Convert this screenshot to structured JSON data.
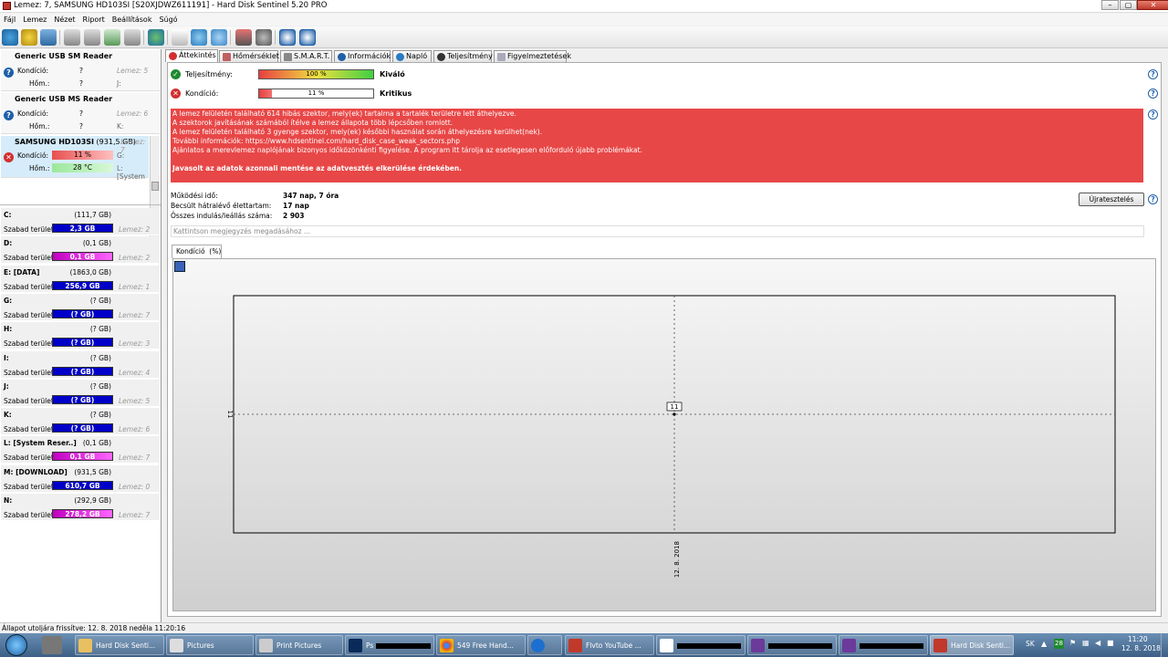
{
  "window": {
    "title": "Lemez: 7, SAMSUNG HD103SI [S20XJDWZ611191] - Hard Disk Sentinel 5.20 PRO"
  },
  "menu": [
    "Fájl",
    "Lemez",
    "Nézet",
    "Riport",
    "Beállítások",
    "Súgó"
  ],
  "disks": [
    {
      "name": "Generic USB SM Reader",
      "cond_label": "Kondíció:",
      "cond_value": "?",
      "cond_lemez": "Lemez: 5",
      "temp_label": "Hőm.:",
      "temp_value": "?",
      "temp_drive": "J:"
    },
    {
      "name": "Generic USB MS Reader",
      "cond_label": "Kondíció:",
      "cond_value": "?",
      "cond_lemez": "Lemez: 6",
      "temp_label": "Hőm.:",
      "temp_value": "?",
      "temp_drive": "K:"
    },
    {
      "name": "SAMSUNG HD103SI",
      "size": "(931,5 GB)",
      "lemez": "Lemez: 7",
      "cond_label": "Kondíció:",
      "cond_value": "11 %",
      "cond_drive": "G:",
      "temp_label": "Hőm.:",
      "temp_value": "28 °C",
      "temp_drive": "L: [System"
    }
  ],
  "volumes": [
    {
      "name": "C:",
      "size": "(111,7 GB)",
      "free_label": "Szabad terület",
      "free": "2,3 GB",
      "lemez": "Lemez: 2",
      "style": "blue"
    },
    {
      "name": "D:",
      "size": "(0,1 GB)",
      "free_label": "Szabad terület",
      "free": "0,1 GB",
      "lemez": "Lemez: 2",
      "style": "mag"
    },
    {
      "name": "E: [DATA]",
      "size": "(1863,0 GB)",
      "free_label": "Szabad terület",
      "free": "256,9 GB",
      "lemez": "Lemez: 1",
      "style": "blue"
    },
    {
      "name": "G:",
      "size": "(? GB)",
      "free_label": "Szabad terület",
      "free": "(? GB)",
      "lemez": "Lemez: 7",
      "style": "blue"
    },
    {
      "name": "H:",
      "size": "(? GB)",
      "free_label": "Szabad terület",
      "free": "(? GB)",
      "lemez": "Lemez: 3",
      "style": "blue"
    },
    {
      "name": "I:",
      "size": "(? GB)",
      "free_label": "Szabad terület",
      "free": "(? GB)",
      "lemez": "Lemez: 4",
      "style": "blue"
    },
    {
      "name": "J:",
      "size": "(? GB)",
      "free_label": "Szabad terület",
      "free": "(? GB)",
      "lemez": "Lemez: 5",
      "style": "blue"
    },
    {
      "name": "K:",
      "size": "(? GB)",
      "free_label": "Szabad terület",
      "free": "(? GB)",
      "lemez": "Lemez: 6",
      "style": "blue"
    },
    {
      "name": "L: [System Reser..]",
      "size": "(0,1 GB)",
      "free_label": "Szabad terület",
      "free": "0,1 GB",
      "lemez": "Lemez: 7",
      "style": "mag"
    },
    {
      "name": "M: [DOWNLOAD]",
      "size": "(931,5 GB)",
      "free_label": "Szabad terület",
      "free": "610,7 GB",
      "lemez": "Lemez: 0",
      "style": "blue"
    },
    {
      "name": "N:",
      "size": "(292,9 GB)",
      "free_label": "Szabad terület",
      "free": "278,2 GB",
      "lemez": "Lemez: 7",
      "style": "mag"
    }
  ],
  "tabs": [
    "Áttekintés",
    "Hőmérséklet",
    "S.M.A.R.T.",
    "Információk",
    "Napló",
    "Teljesítmény",
    "Figyelmeztetések"
  ],
  "overview": {
    "performance_label": "Teljesítmény:",
    "performance_percent": 100,
    "performance_text": "100 %",
    "performance_status": "Kiváló",
    "health_label": "Kondíció:",
    "health_percent": 11,
    "health_text": "11 %",
    "health_status": "Kritikus",
    "alert_lines": [
      "A lemez felületén található 614 hibás szektor, mely(ek) tartalma a tartalék területre lett áthelyezve.",
      "A szektorok javításának számából ítélve a lemez állapota több lépcsőben romlott.",
      "A lemez felületén található 3 gyenge szektor, mely(ek) későbbi használat során áthelyezésre kerülhet(nek).",
      "További információk: https://www.hdsentinel.com/hard_disk_case_weak_sectors.php",
      "Ajánlatos a merevlemez naplójának bizonyos időközönkénti figyelése. A program itt tárolja az esetlegesen előforduló újabb problémákat."
    ],
    "alert_recommendation": "Javasolt az adatok azonnali mentése az adatvesztés elkerülése érdekében.",
    "uptime_label": "Működési idő:",
    "uptime": "347 nap, 7 óra",
    "remaining_label": "Becsült hátralévő élettartam:",
    "remaining": "17 nap",
    "starts_label": "Összes indulás/leállás száma:",
    "starts": "2 903",
    "retest_label": "Újratesztelés",
    "note_placeholder": "Kattintson megjegyzés megadásához ..."
  },
  "chart_tab": "Kondíció  (%)",
  "chart_data": {
    "type": "line",
    "x": [
      "12. 8. 2018"
    ],
    "series": [
      {
        "values": [
          11
        ]
      }
    ],
    "data_labels": [
      "11"
    ],
    "ytick": "11",
    "grid": true
  },
  "statusbar": "Állapot utoljára frissítve: 12. 8. 2018 neděla 11:20:16",
  "taskbar": {
    "items": [
      "Hard Disk Senti...",
      "Pictures",
      "Print Pictures",
      "Ps",
      "549 Free Hand...",
      "Flvto YouTube ...",
      "Hard Disk Senti..."
    ],
    "lang": "SK",
    "time": "11:20",
    "date": "12. 8. 2018",
    "badge": "28"
  },
  "colors": {
    "alert": "#e84747",
    "volume_blue": "#0000c8",
    "volume_magenta": "#c000c0",
    "ok_green": "#1f8a2f",
    "critical_red": "#d32f2f"
  }
}
